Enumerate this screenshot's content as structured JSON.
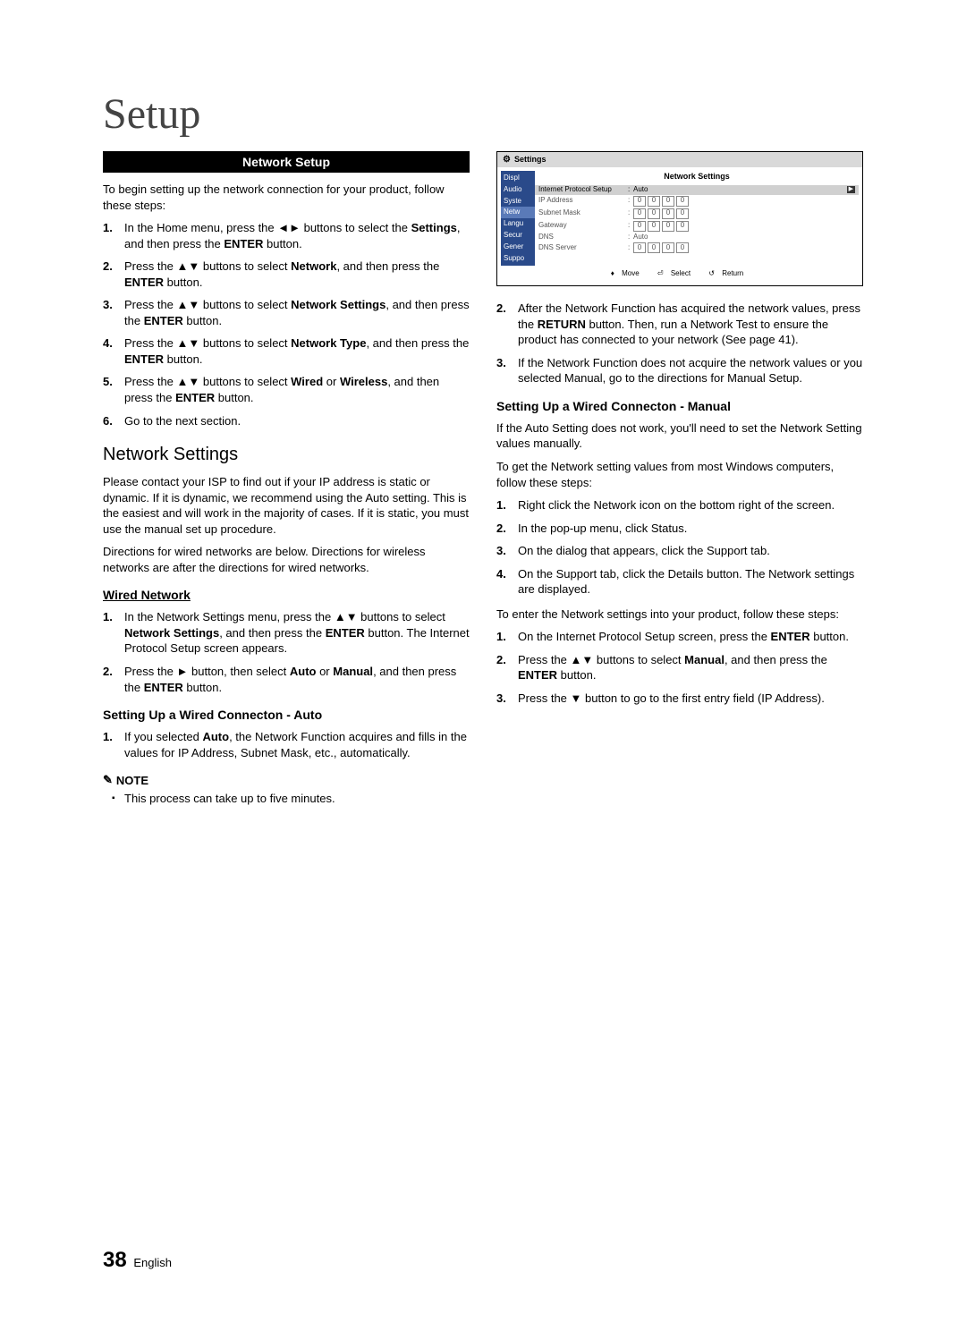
{
  "page_title": "Setup",
  "header_bar": "Network Setup",
  "intro": "To begin setting up the network connection for your product, follow these steps:",
  "steps_top": [
    "In the Home menu, press the ◄► buttons to select the <b>Settings</b>, and then press the <b>ENTER</b> button.",
    "Press the ▲▼ buttons to select <b>Network</b>, and then press the <b>ENTER</b> button.",
    "Press the ▲▼ buttons to select <b>Network Settings</b>, and then press the <b>ENTER</b> button.",
    "Press the ▲▼ buttons to select <b>Network Type</b>, and then press the <b>ENTER</b> button.",
    "Press the ▲▼ buttons to select <b>Wired</b> or <b>Wireless</b>, and then press the <b>ENTER</b> button.",
    "Go to the next section."
  ],
  "section_net_settings": "Network Settings",
  "net_para1": "Please contact your ISP to find out if your IP address is static or dynamic. If it is dynamic, we recommend using the Auto setting. This is the easiest and will work in the majority of cases. If it is static, you must use the manual set up procedure.",
  "net_para2": "Directions for wired networks are below. Directions for wireless networks are after the directions for wired networks.",
  "wired_head": "Wired Network",
  "wired_steps": [
    "In the Network Settings menu, press the ▲▼ buttons to select <b>Network Settings</b>, and then press the <b>ENTER</b> button. The Internet Protocol Setup screen appears.",
    "Press the ► button, then select <b>Auto</b> or <b>Manual</b>, and then press the <b>ENTER</b> button."
  ],
  "wired_auto_head": "Setting Up a Wired Connecton - Auto",
  "wired_auto_steps": [
    "If you selected <b>Auto</b>, the Network Function acquires and fills in the values for IP Address, Subnet Mask, etc., automatically."
  ],
  "note_label": "NOTE",
  "note_text": "This process can take up to five minutes.",
  "right_steps_cont": [
    "After the Network Function has acquired the network values, press the <b>RETURN</b> button. Then, run a Network Test to ensure the product has connected to your network (See page 41).",
    "If the Network Function does not acquire the network values or you selected Manual, go to the directions for Manual Setup."
  ],
  "right_steps_start": 2,
  "wired_manual_head": "Setting Up a Wired Connecton - Manual",
  "wired_manual_para1": "If the Auto Setting does not work, you'll need to set the Network Setting values manually.",
  "wired_manual_para2": "To get the Network setting values from most Windows computers, follow these steps:",
  "manual_get_steps": [
    "Right click the Network icon on the bottom right of the screen.",
    "In the pop-up menu, click Status.",
    "On the dialog that appears, click the Support tab.",
    "On the Support tab, click the Details button. The Network settings are displayed."
  ],
  "wired_manual_para3": "To enter the Network settings into your product, follow these steps:",
  "manual_set_steps": [
    "On the Internet Protocol Setup screen, press the <b>ENTER</b> button.",
    "Press the ▲▼ buttons to select <b>Manual</b>, and then press the <b>ENTER</b> button.",
    "Press the ▼ button to go to the first entry field (IP Address)."
  ],
  "screenshot": {
    "caption": "Settings",
    "panel_title": "Network Settings",
    "sidebar": [
      "Displ",
      "Audio",
      "Syste",
      "Netw",
      "Langu",
      "Secur",
      "Gener",
      "Suppo"
    ],
    "rows": [
      {
        "label": "Internet Protocol Setup",
        "value_type": "text",
        "value": "Auto",
        "selected": true
      },
      {
        "label": "IP Address",
        "value_type": "boxes",
        "values": [
          "0",
          "0",
          "0",
          "0"
        ]
      },
      {
        "label": "Subnet Mask",
        "value_type": "boxes",
        "values": [
          "0",
          "0",
          "0",
          "0"
        ]
      },
      {
        "label": "Gateway",
        "value_type": "boxes",
        "values": [
          "0",
          "0",
          "0",
          "0"
        ]
      },
      {
        "label": "DNS",
        "value_type": "text",
        "value": "Auto"
      },
      {
        "label": "DNS Server",
        "value_type": "boxes",
        "values": [
          "0",
          "0",
          "0",
          "0"
        ]
      }
    ],
    "footer": {
      "move": "Move",
      "select": "Select",
      "return": "Return"
    }
  },
  "page_num": "38",
  "page_lang": "English"
}
